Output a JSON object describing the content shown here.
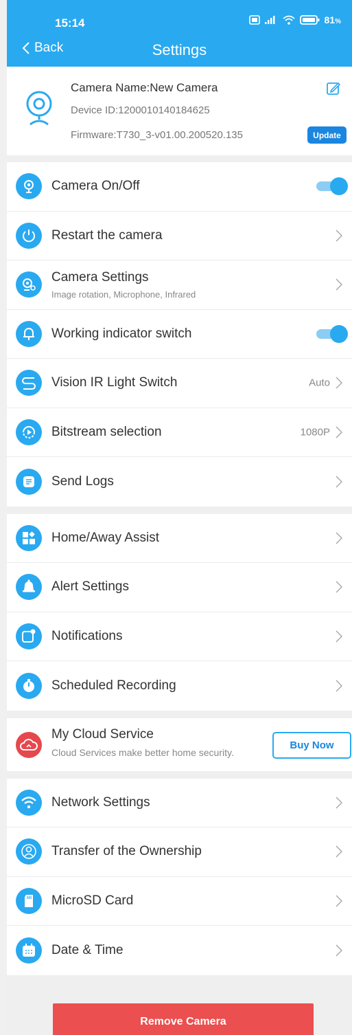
{
  "status": {
    "time": "15:14",
    "battery": "81"
  },
  "header": {
    "back_label": "Back",
    "title": "Settings"
  },
  "camera": {
    "name": "Camera Name:New Camera",
    "device_id": "Device ID:1200010140184625",
    "firmware": "Firmware:T730_3-v01.00.200520.135",
    "update_label": "Update"
  },
  "group1": [
    {
      "label": "Camera On/Off",
      "toggle": true
    },
    {
      "label": "Restart the camera"
    },
    {
      "label": "Camera Settings",
      "sub": "Image rotation, Microphone, Infrared"
    },
    {
      "label": "Working indicator switch",
      "toggle": true
    },
    {
      "label": "Vision IR Light Switch",
      "value": "Auto"
    },
    {
      "label": "Bitstream selection",
      "value": "1080P"
    },
    {
      "label": "Send Logs"
    }
  ],
  "group2": [
    {
      "label": "Home/Away Assist"
    },
    {
      "label": "Alert Settings"
    },
    {
      "label": "Notifications"
    },
    {
      "label": "Scheduled Recording"
    }
  ],
  "cloud": {
    "title": "My Cloud Service",
    "sub": "Cloud Services make better home security.",
    "button": "Buy Now"
  },
  "group3": [
    {
      "label": "Network Settings"
    },
    {
      "label": "Transfer of the Ownership"
    },
    {
      "label": "MicroSD Card"
    },
    {
      "label": "Date & Time"
    }
  ],
  "remove_label": "Remove Camera",
  "colors": {
    "accent": "#29a9f0",
    "danger": "#eb4f4f",
    "update": "#1a86e0"
  }
}
